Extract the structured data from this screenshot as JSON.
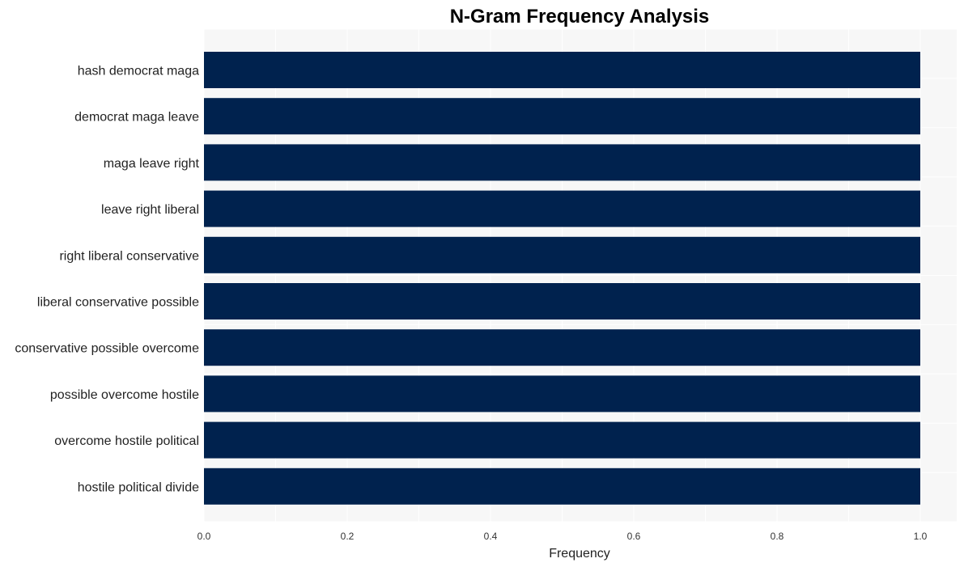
{
  "chart_data": {
    "type": "bar",
    "orientation": "horizontal",
    "title": "N-Gram Frequency Analysis",
    "xlabel": "Frequency",
    "ylabel": "",
    "categories": [
      "hash democrat maga",
      "democrat maga leave",
      "maga leave right",
      "leave right liberal",
      "right liberal conservative",
      "liberal conservative possible",
      "conservative possible overcome",
      "possible overcome hostile",
      "overcome hostile political",
      "hostile political divide"
    ],
    "values": [
      1,
      1,
      1,
      1,
      1,
      1,
      1,
      1,
      1,
      1
    ],
    "xlim": [
      0,
      1.05
    ],
    "xticks": [
      0.0,
      0.2,
      0.4,
      0.6,
      0.8,
      1.0
    ],
    "xtick_labels": [
      "0.0",
      "0.2",
      "0.4",
      "0.6",
      "0.8",
      "1.0"
    ],
    "grid": true,
    "legend": "none",
    "colors": {
      "bar": "#00224e",
      "plot_bg": "#f7f7f7",
      "grid": "#ffffff"
    }
  }
}
